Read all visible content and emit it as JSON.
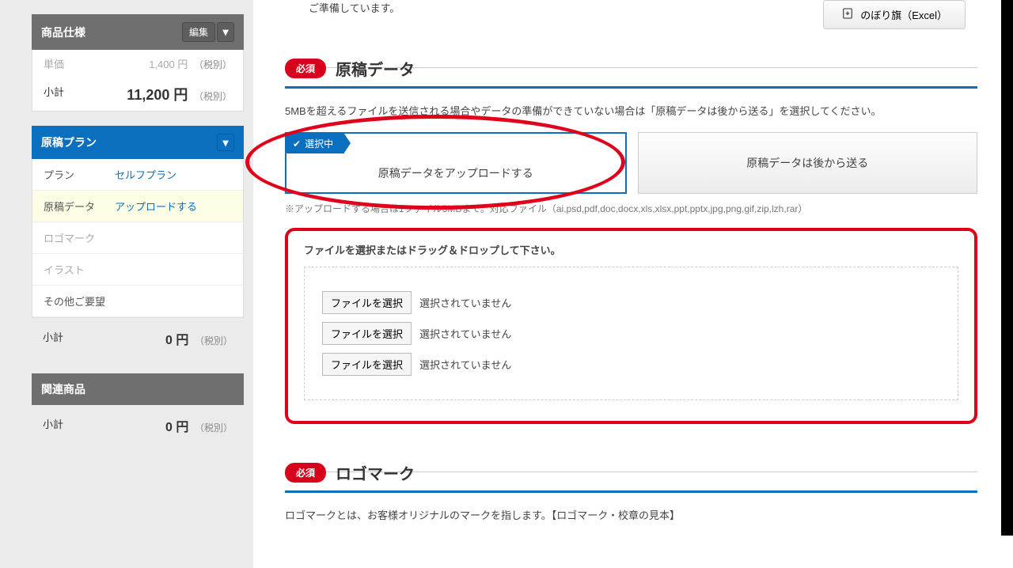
{
  "sidebar": {
    "spec": {
      "title": "商品仕様",
      "edit_btn": "編集",
      "unit_label": "単価",
      "unit_value": "1,400 円",
      "unit_tax": "（税別）",
      "subtotal_label": "小計",
      "subtotal_value": "11,200 円",
      "subtotal_tax": "（税別）"
    },
    "plan": {
      "title": "原稿プラン",
      "rows": [
        {
          "k": "プラン",
          "v": "セルフプラン",
          "link": true
        },
        {
          "k": "原稿データ",
          "v": "アップロードする",
          "link": true,
          "active": true
        },
        {
          "k": "ロゴマーク",
          "v": "",
          "link": false
        },
        {
          "k": "イラスト",
          "v": "",
          "link": false
        },
        {
          "k": "その他ご要望",
          "v": "",
          "link": false
        }
      ],
      "subtotal_label": "小計",
      "subtotal_value": "0 円",
      "subtotal_tax": "（税別）"
    },
    "related": {
      "title": "関連商品",
      "subtotal_label": "小計",
      "subtotal_value": "0 円",
      "subtotal_tax": "（税別）"
    }
  },
  "main": {
    "template_note": "ご準備しています。",
    "download_btn": "のぼり旗（Excel）",
    "section1": {
      "required": "必須",
      "title": "原稿データ",
      "desc": "5MBを超えるファイルを送信される場合やデータの準備ができていない場合は「原稿データは後から送る」を選択してください。",
      "opt_selected_tag": "選択中",
      "opt_upload": "原稿データをアップロードする",
      "opt_later": "原稿データは後から送る",
      "upload_note": "※アップロードする場合は1ファイル5MBまで。対応ファイル（ai,psd,pdf,doc,docx,xls,xlsx,ppt,pptx,jpg,png,gif,zip,lzh,rar）",
      "drop_title": "ファイルを選択またはドラッグ＆ドロップして下さい。",
      "file_btn": "ファイルを選択",
      "file_none": "選択されていません"
    },
    "section2": {
      "required": "必須",
      "title": "ロゴマーク",
      "desc": "ロゴマークとは、お客様オリジナルのマークを指します。【ロゴマーク・校章の見本】"
    }
  }
}
